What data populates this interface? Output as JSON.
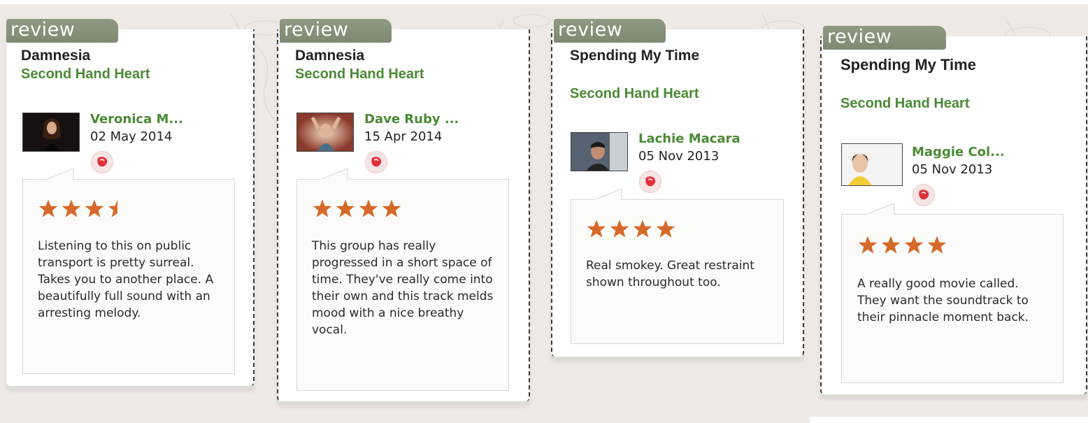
{
  "tag_label": "review",
  "colors": {
    "star": "#d6692a",
    "artist": "#4a8a35",
    "tag": "#858f77"
  },
  "reviews": [
    {
      "song": "Damnesia",
      "artist": "Second Hand Heart",
      "reviewer": "Veronica M...",
      "date": "02 May 2014",
      "rating": 3.5,
      "text": "Listening to this on public transport is pretty surreal. Takes you to another place. A beautifully full sound with an arresting melody."
    },
    {
      "song": "Damnesia",
      "artist": "Second Hand Heart",
      "reviewer": "Dave Ruby ...",
      "date": "15 Apr 2014",
      "rating": 4,
      "text": "This group has really progressed in a short space of time. They've really come into their own and this track melds mood with a nice breathy vocal."
    },
    {
      "song": "Spending My Time",
      "artist": "Second Hand Heart",
      "reviewer": "Lachie Macara",
      "date": "05 Nov 2013",
      "rating": 4,
      "text": "Real smokey. Great restraint shown throughout too."
    },
    {
      "song": "Spending My Time",
      "artist": "Second Hand Heart",
      "reviewer": "Maggie Col...",
      "date": "05 Nov 2013",
      "rating": 4,
      "text": "A really good movie called. They want the soundtrack to their pinnacle moment back."
    }
  ]
}
